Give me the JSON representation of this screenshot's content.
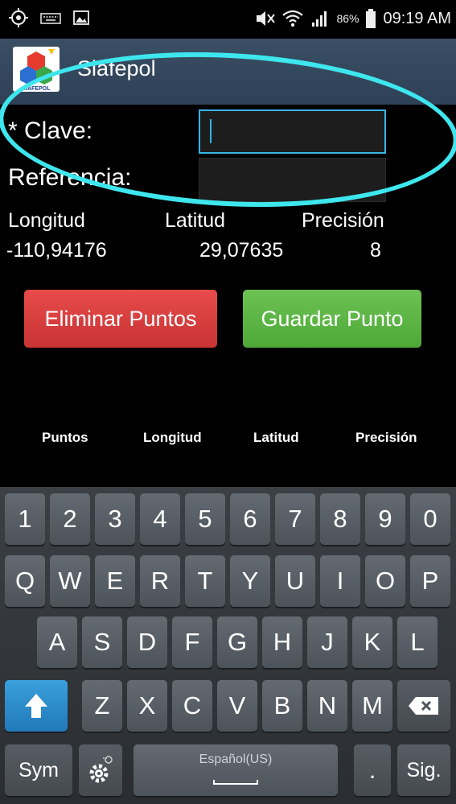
{
  "status_bar": {
    "battery_percent": "86%",
    "time": "09:19 AM",
    "icons": [
      "gps-icon",
      "keyboard-icon",
      "image-icon",
      "mute-icon",
      "wifi-icon",
      "signal-icon",
      "battery-icon"
    ]
  },
  "action_bar": {
    "title": "Siafepol",
    "logo_text": "SIAFEPOL"
  },
  "form": {
    "clave_label": "* Clave:",
    "clave_value": "",
    "referencia_label": "Referencia:",
    "referencia_value": ""
  },
  "coordinates": {
    "headers": [
      "Longitud",
      "Latitud",
      "Precisión"
    ],
    "values": [
      "-110,94176",
      "29,07635",
      "8"
    ]
  },
  "buttons": {
    "delete": "Eliminar Puntos",
    "save": "Guardar Punto"
  },
  "table": {
    "headers": [
      "Puntos",
      "Longitud",
      "Latitud",
      "Precisión"
    ]
  },
  "keyboard": {
    "row_numbers": [
      "1",
      "2",
      "3",
      "4",
      "5",
      "6",
      "7",
      "8",
      "9",
      "0"
    ],
    "row1": [
      "Q",
      "W",
      "E",
      "R",
      "T",
      "Y",
      "U",
      "I",
      "O",
      "P"
    ],
    "row2": [
      "A",
      "S",
      "D",
      "F",
      "G",
      "H",
      "J",
      "K",
      "L"
    ],
    "row3": [
      "Z",
      "X",
      "C",
      "V",
      "B",
      "N",
      "M"
    ],
    "sym": "Sym",
    "space_language": "Español(US)",
    "period": ".",
    "next": "Sig."
  },
  "colors": {
    "focus_accent": "#33b5e5",
    "annotation_ellipse": "#3ee6ee",
    "delete_button": "#d63c3c",
    "save_button": "#5cb544"
  }
}
